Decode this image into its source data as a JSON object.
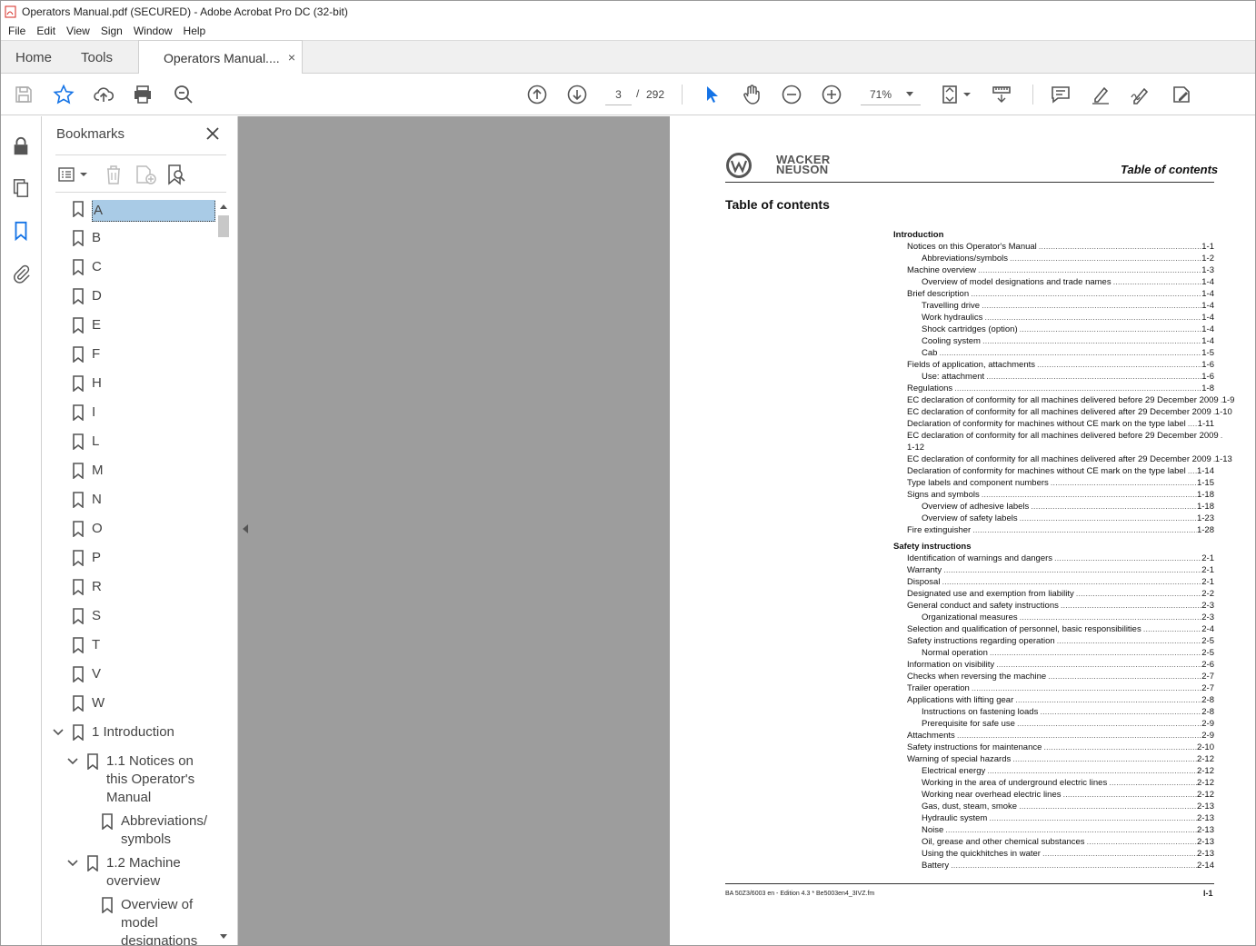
{
  "window": {
    "title": "Operators Manual.pdf (SECURED) - Adobe Acrobat Pro DC (32-bit)"
  },
  "menu": [
    "File",
    "Edit",
    "View",
    "Sign",
    "Window",
    "Help"
  ],
  "tabs": {
    "home": "Home",
    "tools": "Tools",
    "document": "Operators Manual....",
    "close": "×"
  },
  "toolbar": {
    "page_current": "3",
    "page_separator": "/",
    "page_total": "292",
    "zoom": "71%",
    "icons": [
      "save-icon",
      "star-icon",
      "upload-icon",
      "print-icon",
      "zoom-search-icon",
      "page-up-icon",
      "page-down-icon",
      "select-cursor-icon",
      "hand-icon",
      "zoom-out-icon",
      "zoom-in-icon",
      "fit-page-icon",
      "scroll-mode-icon",
      "comment-icon",
      "highlight-icon",
      "sign-icon",
      "edit-icon"
    ]
  },
  "rail": {
    "icons": [
      "lock-icon",
      "pages-icon",
      "bookmark-icon",
      "attachment-icon"
    ]
  },
  "bookmarks": {
    "title": "Bookmarks",
    "items": [
      {
        "label": "A",
        "level": 0,
        "selected": true
      },
      {
        "label": "B",
        "level": 0
      },
      {
        "label": "C",
        "level": 0
      },
      {
        "label": "D",
        "level": 0
      },
      {
        "label": "E",
        "level": 0
      },
      {
        "label": "F",
        "level": 0
      },
      {
        "label": "H",
        "level": 0
      },
      {
        "label": "I",
        "level": 0
      },
      {
        "label": "L",
        "level": 0
      },
      {
        "label": "M",
        "level": 0
      },
      {
        "label": "N",
        "level": 0
      },
      {
        "label": "O",
        "level": 0
      },
      {
        "label": "P",
        "level": 0
      },
      {
        "label": "R",
        "level": 0
      },
      {
        "label": "S",
        "level": 0
      },
      {
        "label": "T",
        "level": 0
      },
      {
        "label": "V",
        "level": 0
      },
      {
        "label": "W",
        "level": 0
      },
      {
        "label": "1 Introduction",
        "level": 0,
        "expanded": true
      },
      {
        "label": "1.1 Notices on this Operator's Manual",
        "level": 1,
        "expanded": true
      },
      {
        "label": "Abbreviations/ symbols",
        "level": 2
      },
      {
        "label": "1.2 Machine overview",
        "level": 1,
        "expanded": true
      },
      {
        "label": "Overview of model designations",
        "level": 2
      }
    ]
  },
  "document": {
    "logo_text": "WACKER NEUSON",
    "header_right": "Table of contents",
    "title": "Table of contents",
    "toc": [
      {
        "text": "Introduction",
        "page": "",
        "level": "sec"
      },
      {
        "text": "Notices on this Operator's Manual",
        "page": "1-1",
        "level": "l1"
      },
      {
        "text": "Abbreviations/symbols",
        "page": "1-2",
        "level": "l2"
      },
      {
        "text": "Machine overview",
        "page": "1-3",
        "level": "l1"
      },
      {
        "text": "Overview of model designations and trade names",
        "page": "1-4",
        "level": "l2"
      },
      {
        "text": "Brief description",
        "page": "1-4",
        "level": "l1"
      },
      {
        "text": "Travelling drive",
        "page": "1-4",
        "level": "l2"
      },
      {
        "text": "Work hydraulics",
        "page": "1-4",
        "level": "l2"
      },
      {
        "text": "Shock cartridges (option)",
        "page": "1-4",
        "level": "l2"
      },
      {
        "text": "Cooling system",
        "page": "1-4",
        "level": "l2"
      },
      {
        "text": "Cab",
        "page": "1-5",
        "level": "l2"
      },
      {
        "text": "Fields of application, attachments",
        "page": "1-6",
        "level": "l1"
      },
      {
        "text": "Use: attachment",
        "page": "1-6",
        "level": "l2"
      },
      {
        "text": "Regulations",
        "page": "1-8",
        "level": "l1"
      },
      {
        "text": "EC declaration of conformity for all machines delivered before 29 December 2009",
        "page": "1-9",
        "level": "l1"
      },
      {
        "text": "EC declaration of conformity for all machines delivered after 29 December 2009",
        "page": "1-10",
        "level": "l1"
      },
      {
        "text": "Declaration of conformity for machines without CE mark on the type label",
        "page": "1-11",
        "level": "l1"
      },
      {
        "text": "EC declaration of conformity for all machines delivered before 29 December 2009",
        "page": "",
        "level": "l1"
      },
      {
        "text": "1-12",
        "page": "",
        "level": "l1",
        "nodots": true
      },
      {
        "text": "EC declaration of conformity for all machines delivered after 29 December 2009",
        "page": "1-13",
        "level": "l1"
      },
      {
        "text": "Declaration of conformity for machines without CE mark on the type label",
        "page": "1-14",
        "level": "l1"
      },
      {
        "text": "Type labels and component numbers",
        "page": "1-15",
        "level": "l1"
      },
      {
        "text": "Signs and symbols",
        "page": "1-18",
        "level": "l1"
      },
      {
        "text": "Overview of adhesive labels",
        "page": "1-18",
        "level": "l2"
      },
      {
        "text": "Overview of safety labels",
        "page": "1-23",
        "level": "l2"
      },
      {
        "text": "Fire extinguisher",
        "page": "1-28",
        "level": "l1"
      },
      {
        "text": "Safety instructions",
        "page": "",
        "level": "sec",
        "gap": true
      },
      {
        "text": "Identification of warnings and dangers",
        "page": "2-1",
        "level": "l1"
      },
      {
        "text": "Warranty",
        "page": "2-1",
        "level": "l1"
      },
      {
        "text": "Disposal",
        "page": "2-1",
        "level": "l1"
      },
      {
        "text": "Designated use and exemption from liability",
        "page": "2-2",
        "level": "l1"
      },
      {
        "text": "General conduct and safety instructions",
        "page": "2-3",
        "level": "l1"
      },
      {
        "text": "Organizational measures",
        "page": "2-3",
        "level": "l2"
      },
      {
        "text": "Selection and qualification of personnel, basic responsibilities",
        "page": "2-4",
        "level": "l1"
      },
      {
        "text": "Safety instructions regarding operation",
        "page": "2-5",
        "level": "l1"
      },
      {
        "text": "Normal operation",
        "page": "2-5",
        "level": "l2"
      },
      {
        "text": "Information on visibility",
        "page": "2-6",
        "level": "l1"
      },
      {
        "text": "Checks when reversing the machine",
        "page": "2-7",
        "level": "l1"
      },
      {
        "text": "Trailer operation",
        "page": "2-7",
        "level": "l1"
      },
      {
        "text": "Applications with lifting gear",
        "page": "2-8",
        "level": "l1"
      },
      {
        "text": "Instructions on fastening loads",
        "page": "2-8",
        "level": "l2"
      },
      {
        "text": "Prerequisite for safe use",
        "page": "2-9",
        "level": "l2"
      },
      {
        "text": "Attachments",
        "page": "2-9",
        "level": "l1"
      },
      {
        "text": "Safety instructions for maintenance",
        "page": "2-10",
        "level": "l1"
      },
      {
        "text": "Warning of special hazards",
        "page": "2-12",
        "level": "l1"
      },
      {
        "text": "Electrical energy",
        "page": "2-12",
        "level": "l2"
      },
      {
        "text": "Working in the area of underground electric lines",
        "page": "2-12",
        "level": "l2"
      },
      {
        "text": "Working near overhead electric lines",
        "page": "2-12",
        "level": "l2"
      },
      {
        "text": "Gas, dust, steam, smoke",
        "page": "2-13",
        "level": "l2"
      },
      {
        "text": "Hydraulic system",
        "page": "2-13",
        "level": "l2"
      },
      {
        "text": "Noise",
        "page": "2-13",
        "level": "l2"
      },
      {
        "text": "Oil, grease and other chemical substances",
        "page": "2-13",
        "level": "l2"
      },
      {
        "text": "Using the quickhitches in water",
        "page": "2-13",
        "level": "l2"
      },
      {
        "text": "Battery",
        "page": "2-14",
        "level": "l2"
      }
    ],
    "footer_left": "BA 50Z3/6003 en - Edition 4.3 * Be5003en4_3IVZ.fm",
    "footer_right": "I-1"
  },
  "colors": {
    "accent_blue": "#1473e6",
    "selection": "#a9cbe6",
    "doc_bg": "#9d9d9d"
  }
}
